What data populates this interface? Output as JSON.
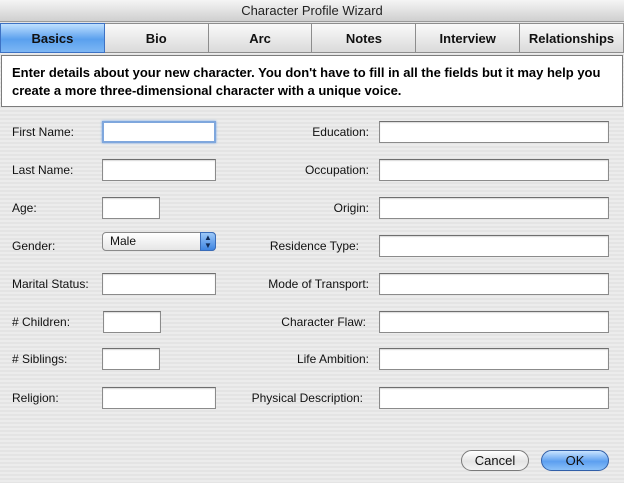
{
  "window": {
    "title": "Character Profile Wizard"
  },
  "tabs": [
    {
      "label": "Basics",
      "active": true
    },
    {
      "label": "Bio"
    },
    {
      "label": "Arc"
    },
    {
      "label": "Notes"
    },
    {
      "label": "Interview"
    },
    {
      "label": "Relationships"
    }
  ],
  "intro": "Enter details about your new character.  You don't have to fill in all the fields but it may help you create a more three-dimensional character with a unique voice.",
  "left_fields": {
    "first_name": {
      "label": "First Name:",
      "value": ""
    },
    "last_name": {
      "label": "Last Name:",
      "value": ""
    },
    "age": {
      "label": "Age:",
      "value": ""
    },
    "gender": {
      "label": "Gender:",
      "value": "Male"
    },
    "marital_status": {
      "label": "Marital Status:",
      "value": ""
    },
    "children": {
      "label": "# Children:",
      "value": ""
    },
    "siblings": {
      "label": "# Siblings:",
      "value": ""
    },
    "religion": {
      "label": "Religion:",
      "value": ""
    }
  },
  "right_fields": {
    "education": {
      "label": "Education:",
      "value": ""
    },
    "occupation": {
      "label": "Occupation:",
      "value": ""
    },
    "origin": {
      "label": "Origin:",
      "value": ""
    },
    "residence_type": {
      "label": "Residence Type:",
      "value": ""
    },
    "mode_of_transport": {
      "label": "Mode of Transport:",
      "value": ""
    },
    "character_flaw": {
      "label": "Character Flaw:",
      "value": ""
    },
    "life_ambition": {
      "label": "Life Ambition:",
      "value": ""
    },
    "physical_description": {
      "label": "Physical Description:",
      "value": ""
    }
  },
  "buttons": {
    "cancel": "Cancel",
    "ok": "OK"
  },
  "colors": {
    "accent": "#5aa0ee",
    "focus_ring": "#7fa7dd"
  }
}
